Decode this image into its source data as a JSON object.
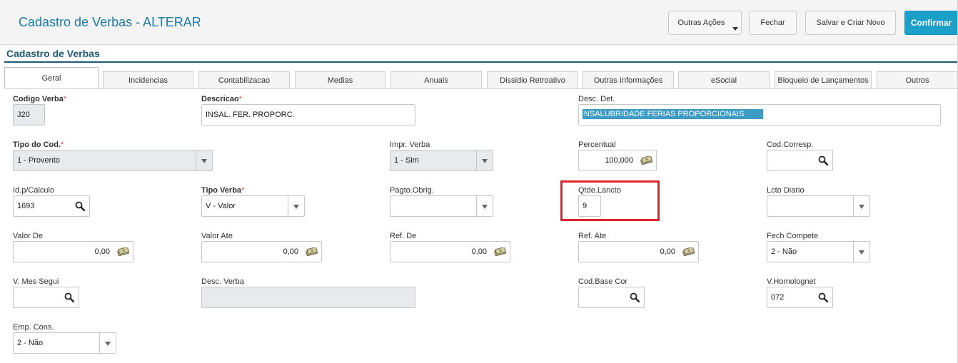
{
  "header": {
    "title": "Cadastro de Verbas - ALTERAR",
    "buttons": {
      "outras_acoes": "Outras Ações",
      "fechar": "Fechar",
      "salvar_criar": "Salvar e Criar Novo",
      "confirmar": "Confirmar"
    }
  },
  "section": {
    "title": "Cadastro de Verbas"
  },
  "tabs": [
    "Geral",
    "Incidencias",
    "Contabilizacao",
    "Medias",
    "Anuais",
    "Dissidio Retroativo",
    "Outras Informações",
    "eSocial",
    "Bloqueio de Lançamentos",
    "Outros"
  ],
  "required_mark": "*",
  "fields": {
    "codigo_verba": {
      "label": "Codigo Verba",
      "value": "J20"
    },
    "descricao": {
      "label": "Descricao",
      "value": "INSAL. FER. PROPORC."
    },
    "desc_det": {
      "label": "Desc. Det.",
      "value": "NSALUBRIDADE FERIAS PROPORCIONAIS"
    },
    "tipo_cod": {
      "label": "Tipo do Cod.",
      "value": "1 - Provento"
    },
    "impr_verba": {
      "label": "Impr. Verba",
      "value": "1 - Sim"
    },
    "percentual": {
      "label": "Percentual",
      "value": "100,000"
    },
    "cod_corresp": {
      "label": "Cod.Corresp.",
      "value": ""
    },
    "id_calculo": {
      "label": "Id.p/Calculo",
      "value": "1693"
    },
    "tipo_verba": {
      "label": "Tipo Verba",
      "value": "V - Valor"
    },
    "pagto_obrig": {
      "label": "Pagto.Obrig.",
      "value": ""
    },
    "qtde_lancto": {
      "label": "Qtde.Lancto",
      "value": "9"
    },
    "lcto_diario": {
      "label": "Lcto Diario",
      "value": ""
    },
    "valor_de": {
      "label": "Valor De",
      "value": "0,00"
    },
    "valor_ate": {
      "label": "Valor Ate",
      "value": "0,00"
    },
    "ref_de": {
      "label": "Ref. De",
      "value": "0,00"
    },
    "ref_ate": {
      "label": "Ref. Ate",
      "value": "0,00"
    },
    "fech_compete": {
      "label": "Fech Compete",
      "value": "2 - Não"
    },
    "v_mes_segui": {
      "label": "V. Mes Segui",
      "value": ""
    },
    "desc_verba": {
      "label": "Desc. Verba",
      "value": ""
    },
    "cod_base_cor": {
      "label": "Cod.Base Cor",
      "value": ""
    },
    "v_homolognet": {
      "label": "V.Homolognet",
      "value": "072"
    },
    "emp_cons": {
      "label": "Emp. Cons.",
      "value": "2 - Não"
    }
  },
  "colors": {
    "accent": "#1aa0c9",
    "title": "#1d7aa8",
    "section": "#1e5a78",
    "highlight": "#e0242d"
  }
}
